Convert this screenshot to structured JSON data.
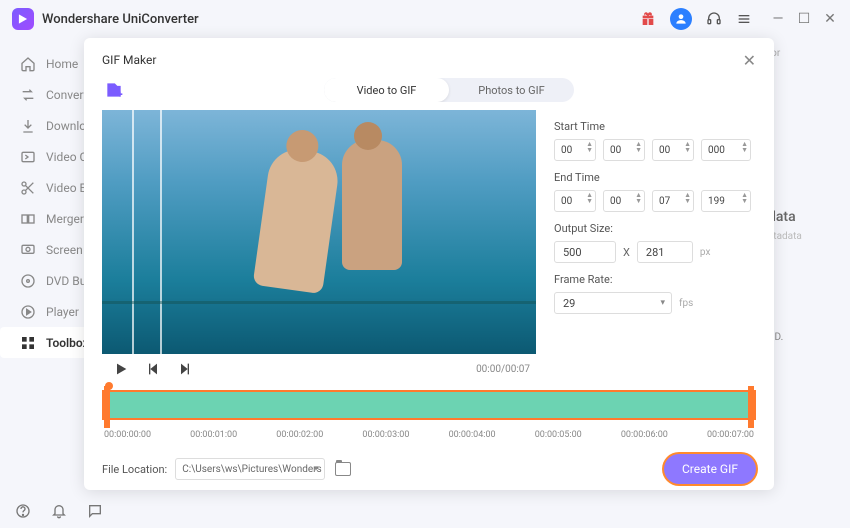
{
  "app": {
    "title": "Wondershare UniConverter"
  },
  "sidebar": {
    "items": [
      {
        "label": "Home"
      },
      {
        "label": "Converter"
      },
      {
        "label": "Downloader"
      },
      {
        "label": "Video Compressor"
      },
      {
        "label": "Video Editor"
      },
      {
        "label": "Merger"
      },
      {
        "label": "Screen Recorder"
      },
      {
        "label": "DVD Burner"
      },
      {
        "label": "Player"
      },
      {
        "label": "Toolbox"
      }
    ]
  },
  "dialog": {
    "title": "GIF Maker",
    "tab_video": "Video to GIF",
    "tab_photos": "Photos to GIF",
    "timecode": "00:00/00:07",
    "labels": {
      "start": "Start Time",
      "end": "End Time",
      "size": "Output Size:",
      "rate": "Frame Rate:",
      "px": "px",
      "fps": "fps",
      "x": "X"
    },
    "start": {
      "hh": "00",
      "mm": "00",
      "ss": "00",
      "ms": "000"
    },
    "end": {
      "hh": "00",
      "mm": "00",
      "ss": "07",
      "ms": "199"
    },
    "size": {
      "w": "500",
      "h": "281"
    },
    "rate": "29",
    "ticks": [
      "00:00:00:00",
      "00:00:01:00",
      "00:00:02:00",
      "00:00:03:00",
      "00:00:04:00",
      "00:00:05:00",
      "00:00:06:00",
      "00:00:07:00"
    ],
    "fileloc_label": "File Location:",
    "fileloc_value": "C:\\Users\\ws\\Pictures\\Wonders",
    "create_btn": "Create GIF"
  },
  "background": {
    "suffix": "tor",
    "data_title": "data",
    "data_sub": "etadata",
    "cd": "CD."
  }
}
